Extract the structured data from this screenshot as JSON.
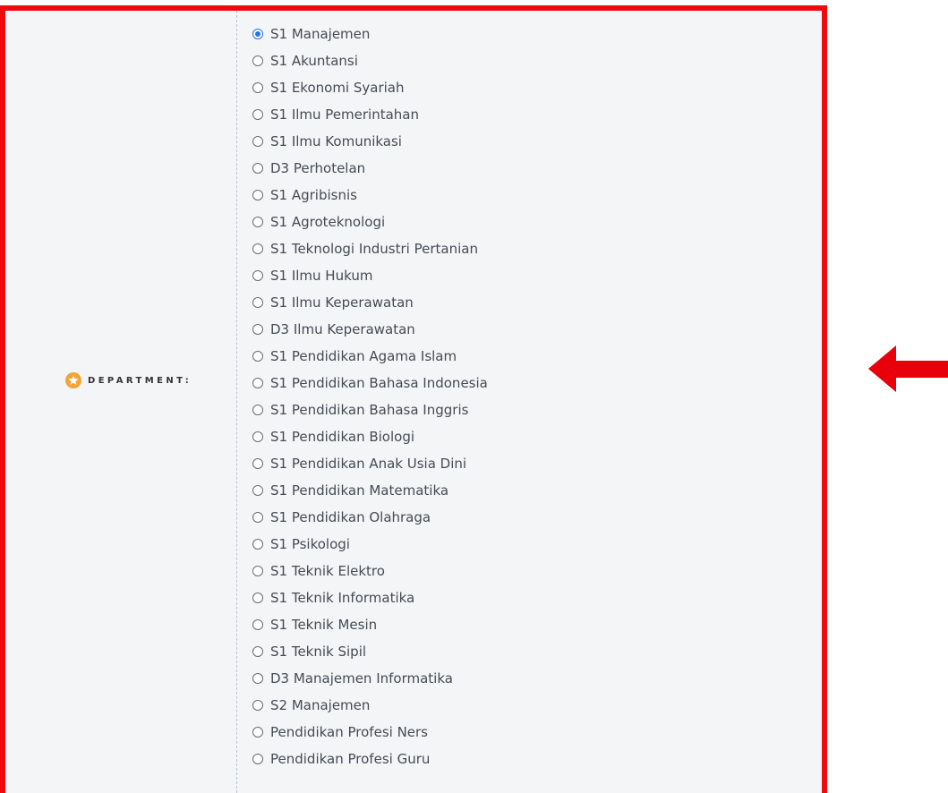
{
  "form": {
    "department_label": "DEPARTMENT:",
    "selected_index": 0,
    "options": [
      "S1 Manajemen",
      "S1 Akuntansi",
      "S1 Ekonomi Syariah",
      "S1 Ilmu Pemerintahan",
      "S1 Ilmu Komunikasi",
      "D3 Perhotelan",
      "S1 Agribisnis",
      "S1 Agroteknologi",
      "S1 Teknologi Industri Pertanian",
      "S1 Ilmu Hukum",
      "S1 Ilmu Keperawatan",
      "D3 Ilmu Keperawatan",
      "S1 Pendidikan Agama Islam",
      "S1 Pendidikan Bahasa Indonesia",
      "S1 Pendidikan Bahasa Inggris",
      "S1 Pendidikan Biologi",
      "S1 Pendidikan Anak Usia Dini",
      "S1 Pendidikan Matematika",
      "S1 Pendidikan Olahraga",
      "S1 Psikologi",
      "S1 Teknik Elektro",
      "S1 Teknik Informatika",
      "S1 Teknik Mesin",
      "S1 Teknik Sipil",
      "D3 Manajemen Informatika",
      "S2 Manajemen",
      "Pendidikan Profesi Ners",
      "Pendidikan Profesi Guru"
    ]
  },
  "icons": {
    "label_icon": "star-circle-icon",
    "annotation": "left-arrow-icon"
  },
  "colors": {
    "highlight_border": "#f10a0d",
    "arrow": "#e8000b",
    "radio_selected": "#1f73e8",
    "star_fill": "#f2a535",
    "panel_background": "#f4f5f7"
  }
}
